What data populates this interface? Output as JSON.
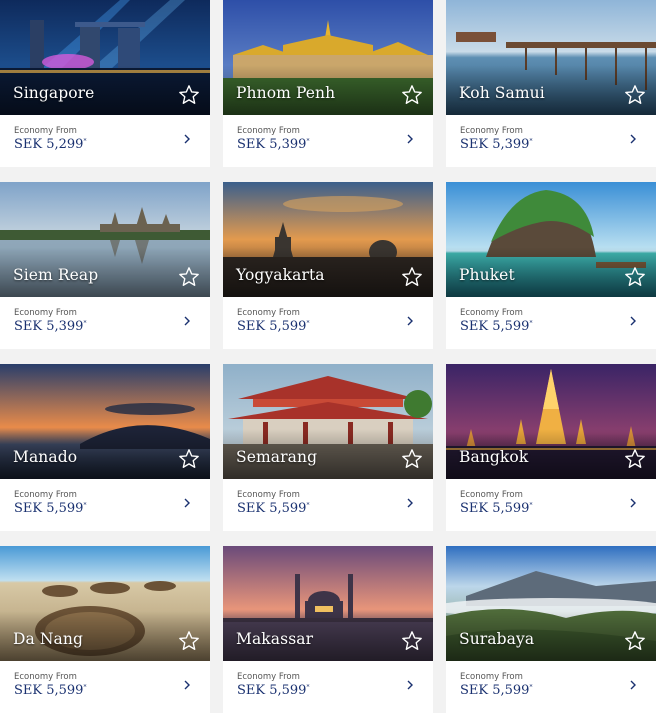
{
  "colors": {
    "page_bg": "#f2f2f2",
    "price_text": "#1a3170",
    "chevron": "#1a3170",
    "city_text": "#ffffff"
  },
  "icons": {
    "favorite": "star-outline-icon",
    "go": "chevron-right-icon"
  },
  "destinations": [
    {
      "city": "Singapore",
      "fare_label": "Economy From",
      "price": "SEK 5,299",
      "note_mark": "*"
    },
    {
      "city": "Phnom Penh",
      "fare_label": "Economy From",
      "price": "SEK 5,399",
      "note_mark": "*"
    },
    {
      "city": "Koh Samui",
      "fare_label": "Economy From",
      "price": "SEK 5,399",
      "note_mark": "*"
    },
    {
      "city": "Siem Reap",
      "fare_label": "Economy From",
      "price": "SEK 5,399",
      "note_mark": "*"
    },
    {
      "city": "Yogyakarta",
      "fare_label": "Economy From",
      "price": "SEK 5,599",
      "note_mark": "*"
    },
    {
      "city": "Phuket",
      "fare_label": "Economy From",
      "price": "SEK 5,599",
      "note_mark": "*"
    },
    {
      "city": "Manado",
      "fare_label": "Economy From",
      "price": "SEK 5,599",
      "note_mark": "*"
    },
    {
      "city": "Semarang",
      "fare_label": "Economy From",
      "price": "SEK 5,599",
      "note_mark": "*"
    },
    {
      "city": "Bangkok",
      "fare_label": "Economy From",
      "price": "SEK 5,599",
      "note_mark": "*"
    },
    {
      "city": "Da Nang",
      "fare_label": "Economy From",
      "price": "SEK 5,599",
      "note_mark": "*"
    },
    {
      "city": "Makassar",
      "fare_label": "Economy From",
      "price": "SEK 5,599",
      "note_mark": "*"
    },
    {
      "city": "Surabaya",
      "fare_label": "Economy From",
      "price": "SEK 5,599",
      "note_mark": "*"
    }
  ]
}
